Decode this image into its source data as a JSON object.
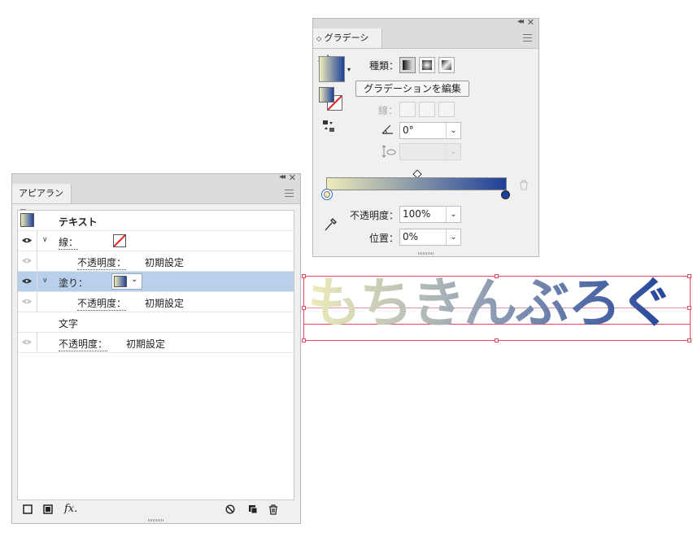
{
  "gradient_panel": {
    "tab_label": "グラデーション",
    "type_label": "種類：",
    "edit_button": "グラデーションを編集",
    "stroke_label": "線：",
    "angle_value": "0°",
    "opacity_label": "不透明度：",
    "opacity_value": "100%",
    "location_label": "位置：",
    "location_value": "0%",
    "colors": {
      "start": "#eeecb8",
      "end": "#1d3f9a"
    }
  },
  "appearance_panel": {
    "tab_label": "アピアランス",
    "header_title": "テキスト",
    "rows": {
      "stroke": {
        "label": "線：",
        "opacity_label": "不透明度：",
        "opacity_value": "初期設定"
      },
      "fill": {
        "label": "塗り：",
        "opacity_label": "不透明度：",
        "opacity_value": "初期設定"
      },
      "characters": {
        "label": "文字"
      },
      "object_opacity": {
        "opacity_label": "不透明度：",
        "opacity_value": "初期設定"
      }
    },
    "footer_fx": "fx."
  },
  "artboard": {
    "text": "もちきんぶろぐ",
    "colors": {
      "start": "#eeecb8",
      "end": "#21439a"
    }
  },
  "colors": {
    "selection_row": "#b8d0ec",
    "selection_box": "#e0455a"
  }
}
